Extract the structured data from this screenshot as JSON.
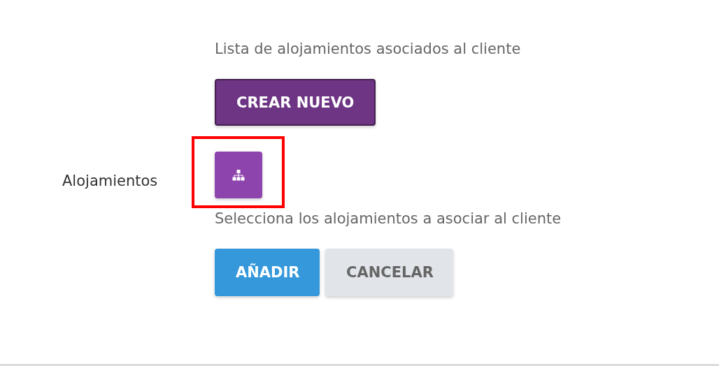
{
  "field": {
    "label": "Alojamientos",
    "list_caption": "Lista de alojamientos asociados al cliente",
    "create_button": "CREAR NUEVO",
    "hierarchy_button": {
      "highlighted": true
    },
    "select_caption": "Selecciona los alojamientos a asociar al cliente",
    "buttons": [
      {
        "label": "AÑADIR",
        "kind": "primary"
      },
      {
        "label": "CANCELAR",
        "kind": "secondary"
      }
    ]
  }
}
